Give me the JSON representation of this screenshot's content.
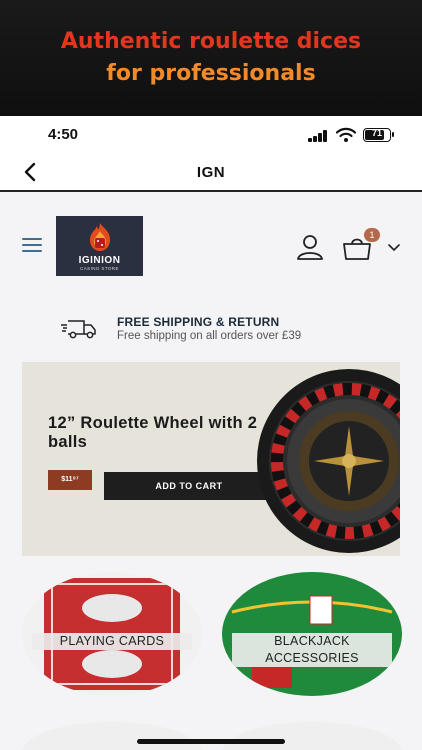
{
  "promo": {
    "line1": "Authentic roulette dices",
    "line2": "for professionals"
  },
  "status_bar": {
    "time": "4:50",
    "battery": "71"
  },
  "nav": {
    "title": "IGN"
  },
  "store": {
    "logo_name": "IGINION",
    "logo_sub": "CASINO STORE",
    "cart_count": "1"
  },
  "shipping": {
    "title": "FREE SHIPPING & RETURN",
    "subtitle": "Free shipping on all orders over £39"
  },
  "banner": {
    "title": "12” Roulette Wheel with 2 balls",
    "price": "$11⁹⁷",
    "add_to_cart": "ADD TO CART"
  },
  "categories": [
    {
      "label": "PLAYING CARDS"
    },
    {
      "label": "BLACKJACK ACCESSORIES"
    }
  ],
  "colors": {
    "promo_red": "#e4361f",
    "promo_orange": "#f28a2a",
    "accent_blue": "#3f6e8f",
    "price_tag": "#8d3b22",
    "cart_badge": "#b46a4a"
  },
  "icons": [
    "back-chevron-icon",
    "hamburger-icon",
    "account-icon",
    "cart-icon",
    "chevron-down-icon",
    "truck-icon",
    "signal-icon",
    "wifi-icon",
    "battery-icon"
  ]
}
